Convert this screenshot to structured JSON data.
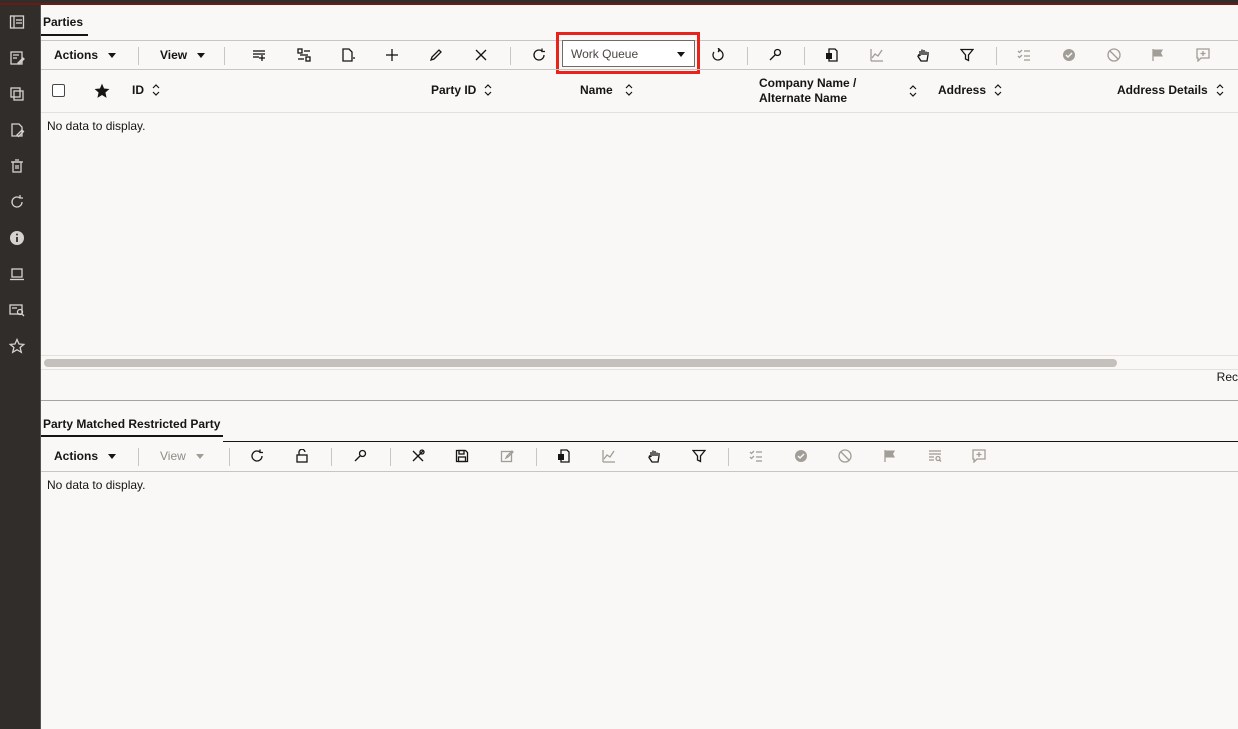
{
  "sidebar": {
    "icons": [
      "dashboard-icon",
      "form-edit-icon",
      "copy-icon",
      "document-edit-icon",
      "trash-icon",
      "refresh-icon",
      "info-icon",
      "laptop-icon",
      "search-list-icon",
      "star-icon"
    ]
  },
  "parties": {
    "title": "Parties",
    "actions_label": "Actions",
    "view_label": "View",
    "work_queue": {
      "value": "Work Queue"
    },
    "columns": [
      "ID",
      "Party ID",
      "Name",
      "Company Name /",
      "Alternate Name",
      "Address",
      "Address Details"
    ],
    "empty_message": "No data to display.",
    "records_text": "Rec"
  },
  "matched": {
    "title": "Party Matched Restricted Party",
    "actions_label": "Actions",
    "view_label": "View",
    "empty_message": "No data to display."
  },
  "colors": {
    "highlight": "#e8231b",
    "sidebar": "#312d2a",
    "background": "#f9f8f6"
  }
}
